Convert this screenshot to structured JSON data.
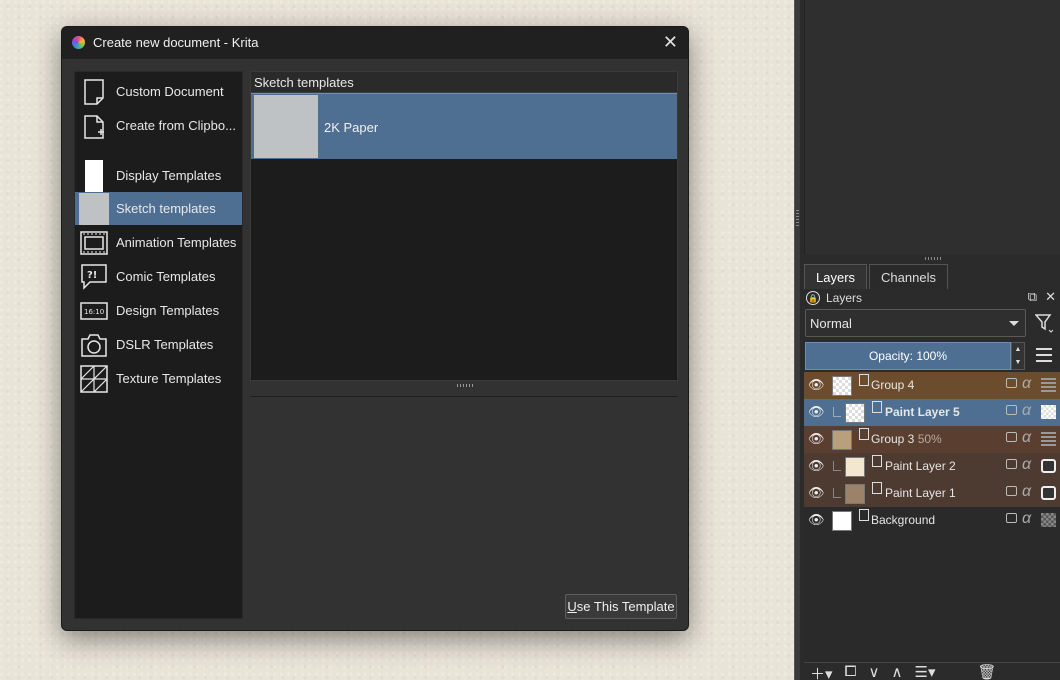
{
  "dialog": {
    "title": "Create new document - Krita",
    "close_glyph": "✕",
    "sidebar": [
      {
        "label": "Custom Document",
        "icon": "blank-page-icon"
      },
      {
        "label": "Create from Clipbo...",
        "icon": "clipboard-page-icon"
      },
      {
        "label": "Display Templates",
        "icon": "display-white-rect-icon"
      },
      {
        "label": "Sketch templates",
        "icon": "sketch-gray-rect-icon",
        "selected": true
      },
      {
        "label": "Animation Templates",
        "icon": "animation-film-icon"
      },
      {
        "label": "Comic Templates",
        "icon": "speech-bubble-icon",
        "glyph": "?!"
      },
      {
        "label": "Design Templates",
        "icon": "aspect-ratio-icon",
        "glyph": "16:10"
      },
      {
        "label": "DSLR Templates",
        "icon": "camera-icon"
      },
      {
        "label": "Texture Templates",
        "icon": "texture-tiles-icon"
      }
    ],
    "templates_header": "Sketch templates",
    "template_items": [
      {
        "name": "2K Paper"
      }
    ],
    "use_button": {
      "mnemonic": "U",
      "rest": "se This Template"
    }
  },
  "layers_panel": {
    "tabs": [
      "Layers",
      "Channels"
    ],
    "active_tab": "Layers",
    "docker_title": "Layers",
    "blend_mode": "Normal",
    "opacity_label": "Opacity:  100%",
    "layers": [
      {
        "name": "Group 4",
        "suffix": "",
        "type": "group",
        "bold": false,
        "bg": "#6b4c2c"
      },
      {
        "name": "Paint Layer 5",
        "suffix": "",
        "type": "paint",
        "bold": true,
        "bg": "#4e6f92"
      },
      {
        "name": "Group 3",
        "suffix": "50%",
        "type": "group",
        "bold": false,
        "bg": "#5a3e30"
      },
      {
        "name": "Paint Layer 2",
        "suffix": "",
        "type": "paint",
        "bold": false,
        "bg": "#4d3a30"
      },
      {
        "name": "Paint Layer 1",
        "suffix": "",
        "type": "paint",
        "bold": false,
        "bg": "#4d3a30"
      },
      {
        "name": "Background",
        "suffix": "",
        "type": "paint",
        "bold": false,
        "bg": "#2a2a2a"
      }
    ],
    "bottom_tools": [
      "add-layer-icon",
      "duplicate-icon",
      "move-down-icon",
      "move-up-icon",
      "properties-icon",
      "delete-icon"
    ]
  },
  "colors": {
    "selection": "#4e6f92",
    "dialog_bg": "#323232",
    "list_bg": "#1c1c1c"
  }
}
